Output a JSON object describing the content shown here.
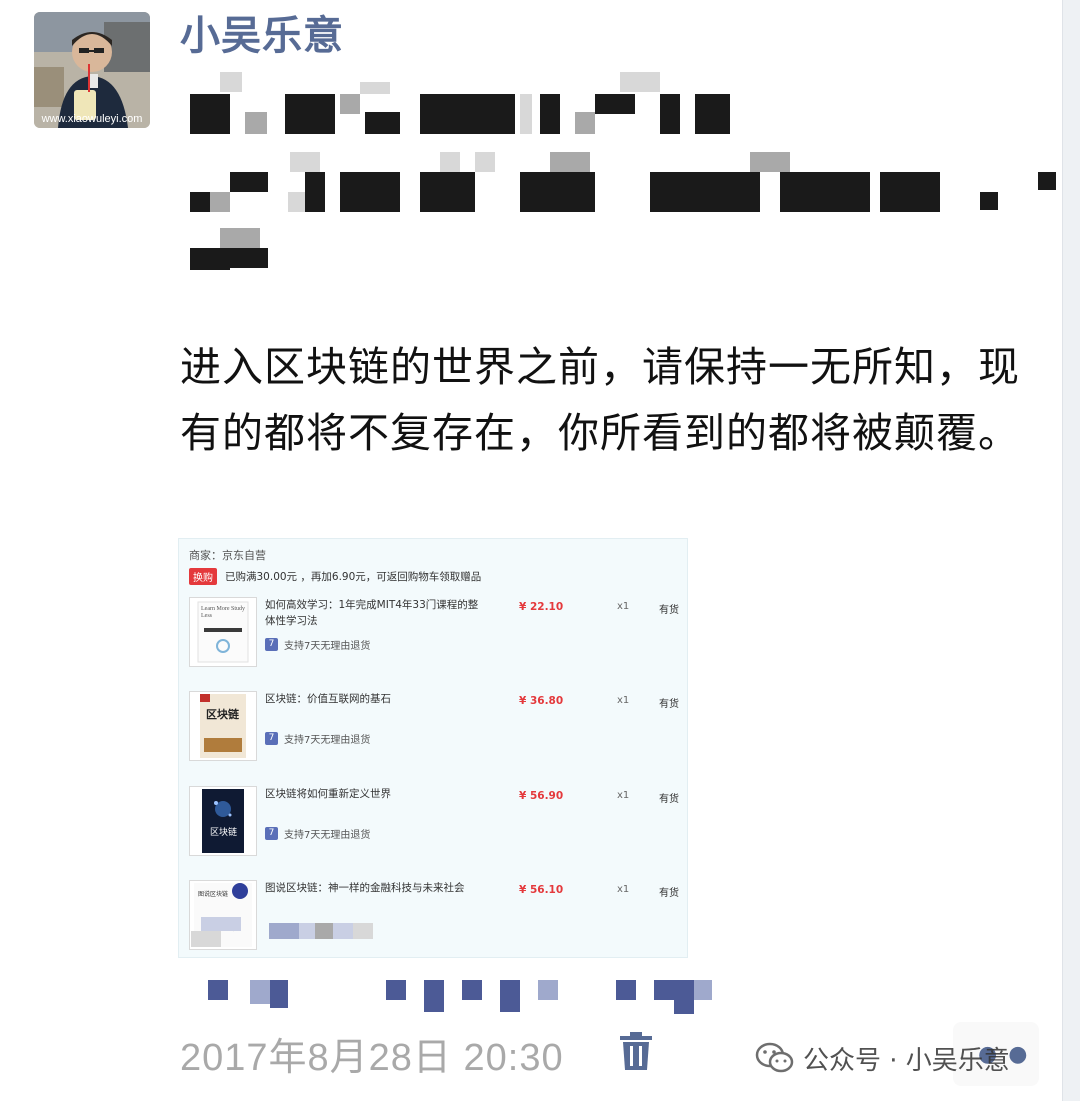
{
  "post": {
    "author_name": "小吴乐意",
    "avatar_caption": "www.xiaowuleyi.com",
    "text": "进入区块链的世界之前，请保持一无所知，现有的都将不复存在，你所看到的都将被颠覆。",
    "timestamp": "2017年8月28日 20:30"
  },
  "order": {
    "merchant": "商家：京东自营",
    "promo_badge": "换购",
    "promo_text": "已购满30.00元 ，再加6.90元，可返回购物车领取赠品",
    "return_policy": "支持7天无理由退货",
    "items": [
      {
        "title": "如何高效学习：1年完成MIT4年33门课程的整体性学习法",
        "price": "¥ 22.10",
        "qty": "x1",
        "stock": "有货"
      },
      {
        "title": "区块链：价值互联网的基石",
        "price": "¥ 36.80",
        "qty": "x1",
        "stock": "有货"
      },
      {
        "title": "区块链将如何重新定义世界",
        "price": "¥ 56.90",
        "qty": "x1",
        "stock": "有货"
      },
      {
        "title": "图说区块链：神一样的金融科技与未来社会",
        "price": "¥ 56.10",
        "qty": "x1",
        "stock": "有货"
      }
    ],
    "cover_texts": {
      "book1": "Learn More Study Less",
      "book2": "区块链",
      "book3": "区块链",
      "book4": "图说区块链"
    }
  },
  "watermark": "公众号 · 小吴乐意",
  "colors": {
    "link_blue": "#576b95",
    "price_red": "#e4393c",
    "card_bg": "#f3fafc",
    "timestamp_gray": "#a9a9a9"
  },
  "icons": [
    "trash-icon",
    "wechat-icon",
    "more-icon",
    "return-icon"
  ]
}
